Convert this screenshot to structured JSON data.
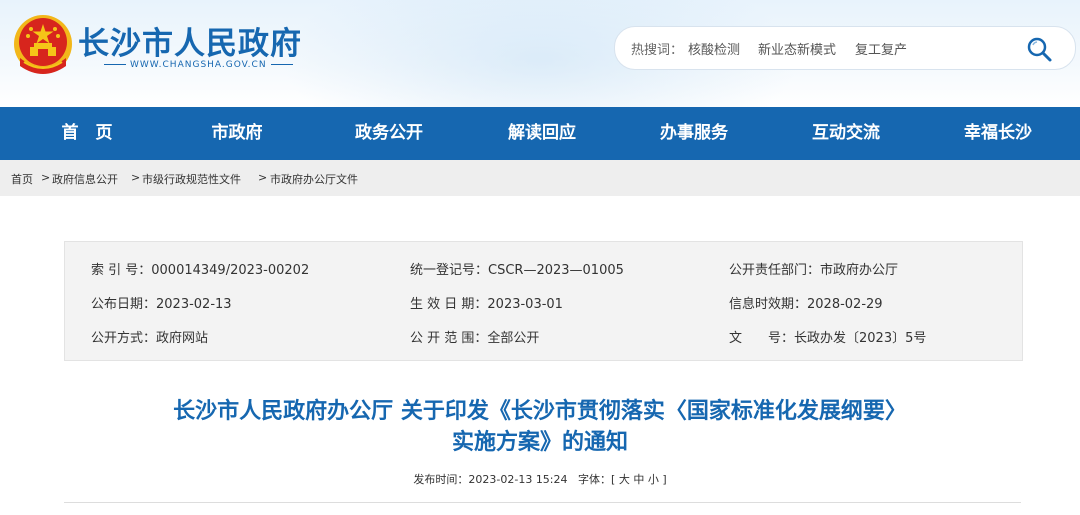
{
  "header": {
    "site_title": "长沙市人民政府",
    "site_domain": "WWW.CHANGSHA.GOV.CN",
    "emblem_icon": "national-emblem-icon",
    "search": {
      "hot_label": "热搜词：",
      "keywords": [
        "核酸检测",
        "新业态新模式",
        "复工复产"
      ],
      "search_icon": "search-icon"
    }
  },
  "nav": {
    "items": [
      "首　页",
      "市政府",
      "政务公开",
      "解读回应",
      "办事服务",
      "互动交流",
      "幸福长沙"
    ]
  },
  "breadcrumb": {
    "items": [
      "首页",
      "政府信息公开",
      "市级行政规范性文件",
      "市政府办公厅文件"
    ],
    "separator": ">"
  },
  "info": {
    "index_no": "索 引 号：000014349/2023-00202",
    "reg_no": "统一登记号：CSCR—2023—01005",
    "dept": "公开责任部门：市政府办公厅",
    "publish_date": "公布日期：2023-02-13",
    "effective_date": "生 效 日 期：2023-03-01",
    "expire_date": "信息时效期：2028-02-29",
    "publish_method": "公开方式：政府网站",
    "scope": "公 开 范 围：全部公开",
    "doc_no": "文　　号：长政办发〔2023〕5号"
  },
  "article": {
    "title_line1": "长沙市人民政府办公厅 关于印发《长沙市贯彻落实〈国家标准化发展纲要〉",
    "title_line2": "实施方案》的通知",
    "meta_time": "发布时间：2023-02-13 15:24",
    "meta_font_label": "字体：[",
    "font_large": "大",
    "font_medium": "中",
    "font_small": "小",
    "meta_font_end": "]"
  },
  "colors": {
    "brand_blue": "#1667b0",
    "emblem_red": "#d7251d",
    "emblem_gold": "#f5c518"
  }
}
